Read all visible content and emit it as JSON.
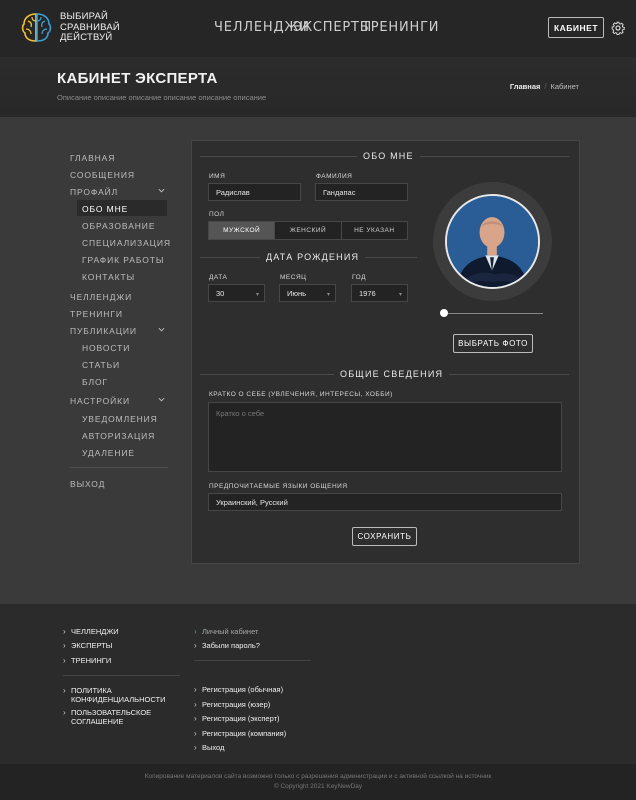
{
  "brand": {
    "line1": "ВЫБИРАЙ",
    "line2": "СРАВНИВАЙ",
    "line3": "ДЕЙСТВУЙ"
  },
  "nav": {
    "challenges": "ЧЕЛЛЕНДЖИ",
    "experts": "ЭКСПЕРТЫ",
    "trainings": "ТРЕНИНГИ"
  },
  "header": {
    "cabinet_label": "КАБИНЕТ"
  },
  "page": {
    "title": "КАБИНЕТ ЭКСПЕРТА",
    "description": "Описание описание описание описание описание описание",
    "breadcrumb_home": "Главная",
    "breadcrumb_sep": "/",
    "breadcrumb_current": "Кабинет"
  },
  "sidebar": {
    "home": "ГЛАВНАЯ",
    "messages": "СООБЩЕНИЯ",
    "profile": "ПРОФАЙЛ",
    "about": "ОБО МНЕ",
    "education": "ОБРАЗОВАНИЕ",
    "specialization": "СПЕЦИАЛИЗАЦИЯ",
    "schedule": "ГРАФИК РАБОТЫ",
    "contacts": "КОНТАКТЫ",
    "challenges": "ЧЕЛЛЕНДЖИ",
    "trainings": "ТРЕНИНГИ",
    "publications": "ПУБЛИКАЦИИ",
    "news": "НОВОСТИ",
    "articles": "СТАТЬИ",
    "blog": "БЛОГ",
    "settings": "НАСТРОЙКИ",
    "notifications": "УВЕДОМЛЕНИЯ",
    "authorization": "АВТОРИЗАЦИЯ",
    "deletion": "УДАЛЕНИЕ",
    "logout": "ВЫХОД"
  },
  "form": {
    "about_title": "ОБО МНЕ",
    "name_label": "ИМЯ",
    "name_value": "Радислав",
    "surname_label": "ФАМИЛИЯ",
    "surname_value": "Гандапас",
    "gender_label": "ПОЛ",
    "gender_male": "МУЖСКОЙ",
    "gender_female": "ЖЕНСКИЙ",
    "gender_none": "НЕ УКАЗАН",
    "birth_title": "ДАТА РОЖДЕНИЯ",
    "day_label": "ДАТА",
    "day_value": "30",
    "month_label": "МЕСЯЦ",
    "month_value": "Июнь",
    "year_label": "ГОД",
    "year_value": "1976",
    "photo_button": "ВЫБРАТЬ ФОТО",
    "general_title": "ОБЩИЕ СВЕДЕНИЯ",
    "bio_label": "КРАТКО О СЕБЕ (УВЛЕЧЕНИЯ, ИНТЕРЕСЫ, ХОББИ)",
    "bio_placeholder": "Кратко о себе",
    "langs_label": "ПРЕДПОЧИТАЕМЫЕ ЯЗЫКИ ОБЩЕНИЯ",
    "langs_value": "Украинский, Русский",
    "save_button": "СОХРАНИТЬ"
  },
  "footer": {
    "col1": [
      "ЧЕЛЛЕНДЖИ",
      "ЭКСПЕРТЫ",
      "ТРЕНИНГИ"
    ],
    "policy": "ПОЛИТИКА КОНФИДЕНЦИАЛЬНОСТИ",
    "agreement": "ПОЛЬЗОВАТЕЛЬСКОЕ СОГЛАШЕНИЕ",
    "cabinet": "Личный кабинет",
    "forgot": "Забыли пароль?",
    "reg": [
      "Регистрация (обычная)",
      "Регистрация (юзер)",
      "Регистрация (эксперт)",
      "Регистрация (компания)",
      "Выход"
    ],
    "copy1": "Копирование материалов сайта возможно только с разрешения администрации и с активной ссылкой на источник",
    "copy2": "© Copyright 2021 KeyNewDay"
  },
  "colors": {
    "accent_yellow": "#f2c230",
    "accent_blue": "#3aa0d8",
    "avatar_bg": "#2a5d96"
  },
  "icons": {
    "gear": "gear-icon",
    "chevron": "chevron-down-icon",
    "logo": "brain-logo-icon"
  }
}
